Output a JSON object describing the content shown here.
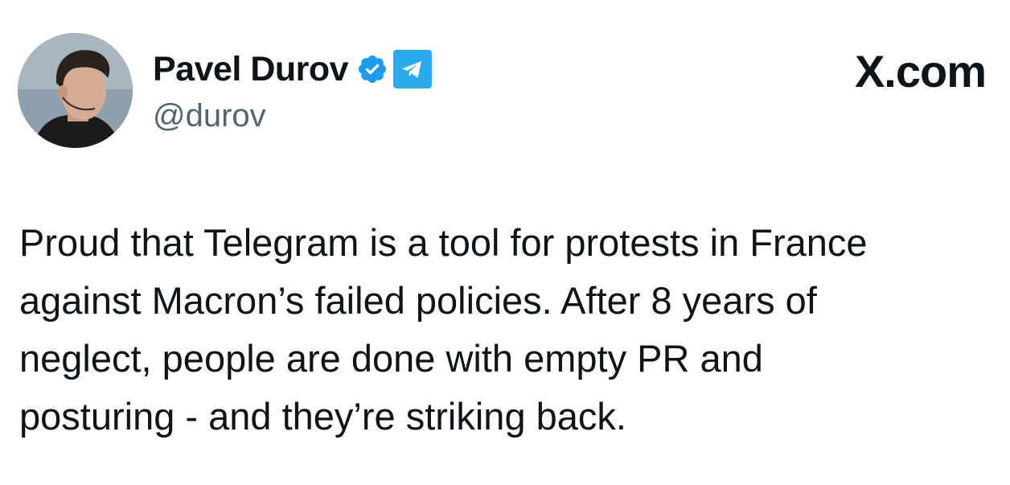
{
  "tweet": {
    "author": {
      "display_name": "Pavel Durov",
      "handle": "@durov",
      "verified_icon": "verified-badge-icon",
      "affiliation_icon": "telegram-icon"
    },
    "brand": "X.com",
    "text_lines": [
      "Proud that Telegram is a tool for protests in France",
      "against Macron’s failed policies. After 8 years of",
      "neglect, people are done with empty PR and",
      "posturing - and they’re striking back."
    ]
  },
  "colors": {
    "text": "#0f1419",
    "handle": "#536471",
    "verified": "#1d9bf0",
    "telegram": "#2aabee",
    "background": "#ffffff"
  }
}
